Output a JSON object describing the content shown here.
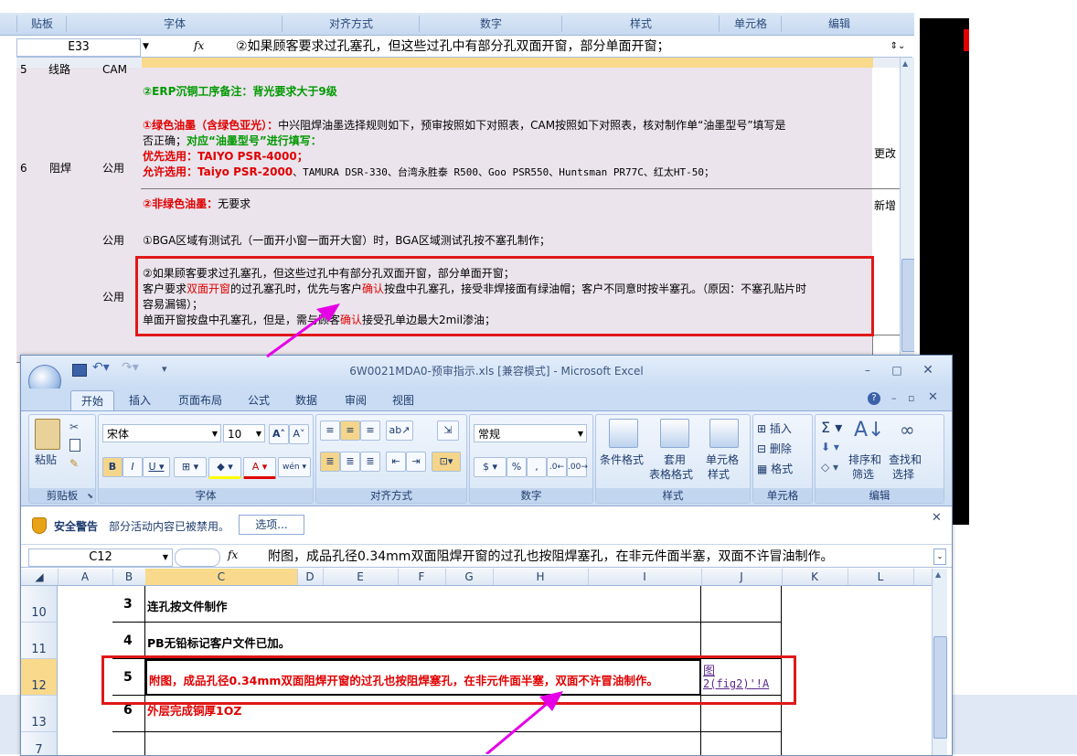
{
  "background_sheet": {
    "ribbon_groups": [
      "贴板",
      "字体",
      "对齐方式",
      "数字",
      "样式",
      "单元格",
      "编辑"
    ],
    "cell_ref": "E33",
    "formula": "②如果顾客要求过孔塞孔，但这些过孔中有部分孔双面开窗，部分单面开窗；",
    "row5": {
      "no": "5",
      "name": "线路",
      "type": "CAM",
      "text": "②ERP沉铜工序备注：背光要求大于9级"
    },
    "row6": {
      "no": "6",
      "name": "阻焊",
      "type": "公用",
      "line1_red": "①绿色油墨（含绿色亚光）：",
      "line1_rest": "中兴阻焊油墨选择规则如下，预审按照如下对照表，CAM按照如下对照表，核对制作单“油墨型号”填写是",
      "line2_a": "否正确；",
      "line2_b": "对应“油墨型号”进行填写：",
      "line3": "优先选用：TAIYO PSR-4000；",
      "line4_a": "允许选用：Taiyo PSR-2000",
      "line4_b": "、TAMURA DSR-330、台湾永胜泰 R500、Goo PSR550、Huntsman PR77C、红太HT-50；",
      "note1": "更改",
      "line5_red": "②非绿色油墨：",
      "line5_rest": "无要求",
      "note2": "新增"
    },
    "row7": {
      "type": "公用",
      "text": "①BGA区域有测试孔（一面开小窗一面开大窗）时，BGA区域测试孔按不塞孔制作；"
    },
    "row8": {
      "type": "公用",
      "l1": "②如果顾客要求过孔塞孔，但这些过孔中有部分孔双面开窗，部分单面开窗；",
      "l2a": "客户要求",
      "l2b": "双面开窗",
      "l2c": "的过孔塞孔时，优先与客户",
      "l2d": "确认",
      "l2e": "按盘中孔塞孔，接受非焊接面有绿油帽；客户不同意时按半塞孔。（原因：不塞孔贴片时",
      "l3": "容易漏锡）；",
      "l4a": "单面开窗按盘中孔塞孔，但是，需与顾客",
      "l4b": "确认",
      "l4c": "接受孔单边最大2mil渗油；"
    }
  },
  "window": {
    "title": "6W0021MDA0-预审指示.xls  [兼容模式] - Microsoft Excel",
    "tabs": [
      "开始",
      "插入",
      "页面布局",
      "公式",
      "数据",
      "审阅",
      "视图"
    ],
    "ribbon": {
      "paste": "粘贴",
      "clipboard": "剪贴板",
      "font_name": "宋体",
      "font_size": "10",
      "font_group": "字体",
      "align_group": "对齐方式",
      "number_format": "常规",
      "number_group": "数字",
      "cond_format": "条件格式",
      "table_format_1": "套用",
      "table_format_2": "表格格式",
      "cell_style_1": "单元格",
      "cell_style_2": "样式",
      "style_group": "样式",
      "insert": "插入",
      "delete": "删除",
      "format": "格式",
      "cells_group": "单元格",
      "sort_1": "排序和",
      "sort_2": "筛选",
      "find_1": "查找和",
      "find_2": "选择",
      "edit_group": "编辑"
    },
    "security": {
      "title": "安全警告",
      "message": "部分活动内容已被禁用。",
      "button": "选项..."
    },
    "cell_ref": "C12",
    "formula": "附图，成品孔径0.34mm双面阻焊开窗的过孔也按阻焊塞孔，在非元件面半塞，双面不许冒油制作。",
    "columns": [
      "A",
      "B",
      "C",
      "D",
      "E",
      "F",
      "G",
      "H",
      "I",
      "J",
      "K",
      "L"
    ],
    "rows": [
      {
        "row": "10",
        "no": "3",
        "text": "连孔按文件制作",
        "link": ""
      },
      {
        "row": "11",
        "no": "4",
        "text": "PB无铅标记客户文件已加。",
        "link": ""
      },
      {
        "row": "12",
        "no": "5",
        "text": "附图，成品孔径0.34mm双面阻焊开窗的过孔也按阻焊塞孔，在非元件面半塞，双面不许冒油制作。",
        "link_1": "图",
        "link_2": "2(fig2)'!A"
      },
      {
        "row": "13",
        "no": "6",
        "text": "外层完成铜厚1OZ",
        "link": ""
      }
    ]
  },
  "colors": {
    "annotation_red": "#e01818",
    "arrow_magenta": "#e600e6",
    "selected_header": "#f9d98b"
  }
}
